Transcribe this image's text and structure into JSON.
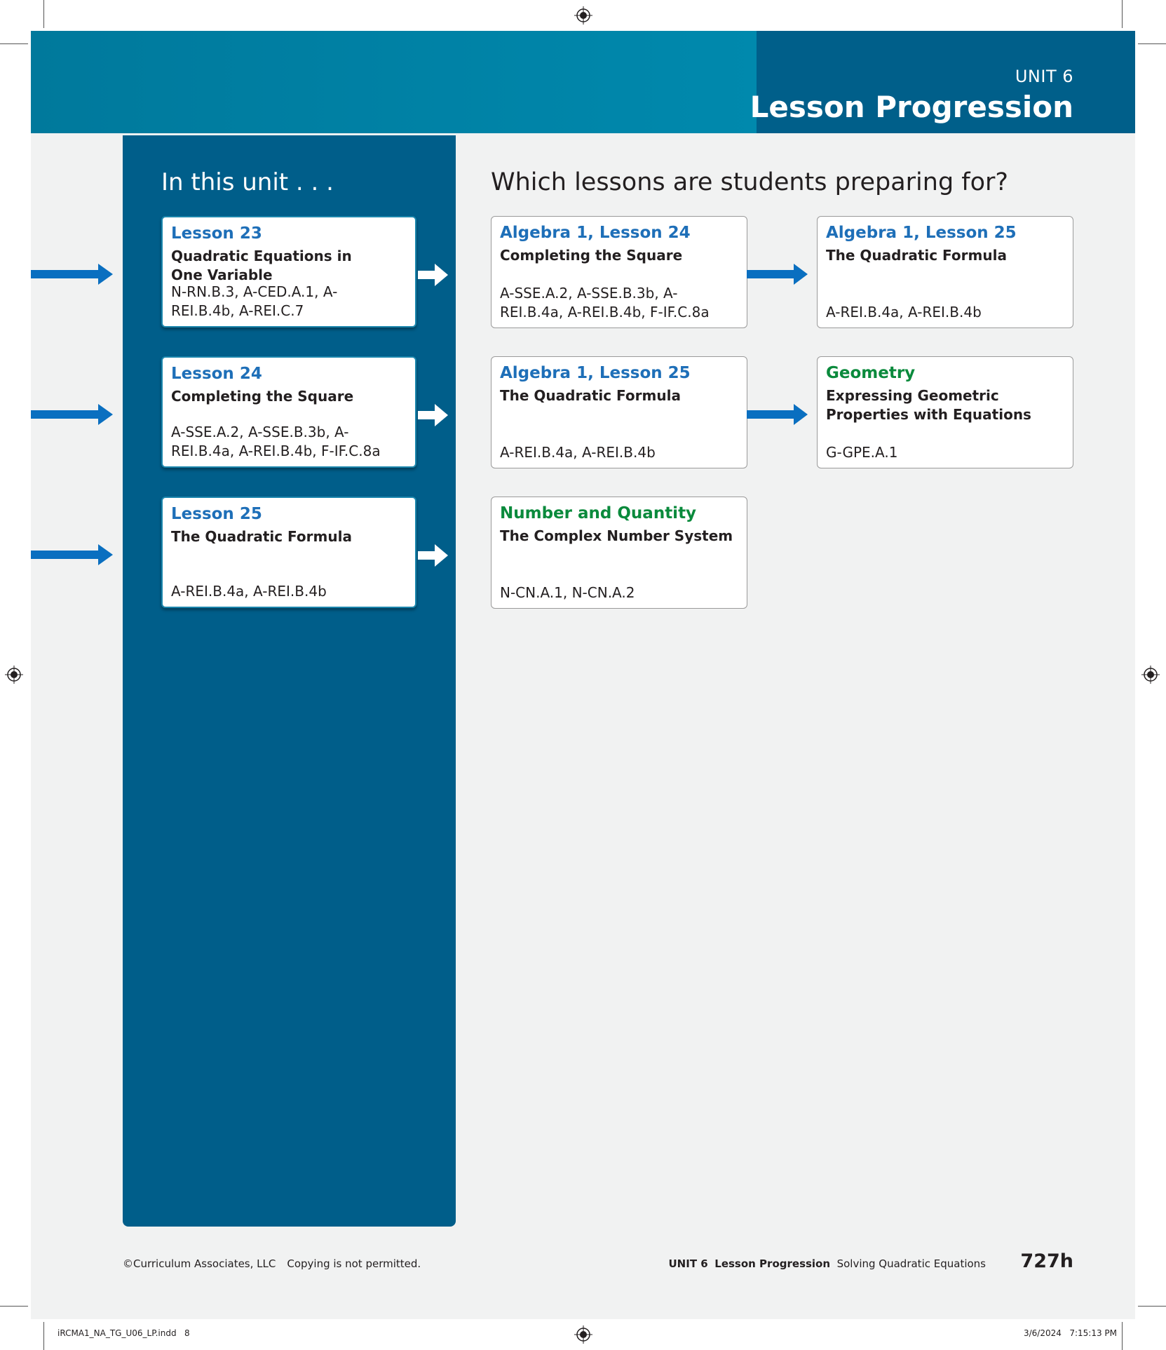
{
  "header": {
    "unit_label": "UNIT 6",
    "title": "Lesson Progression"
  },
  "left": {
    "heading": "In this unit . . .",
    "lessons": [
      {
        "title": "Lesson 23",
        "name": "Quadratic Equations in One Variable",
        "standards": "N-RN.B.3, A-CED.A.1, A-REI.B.4b, A-REI.C.7"
      },
      {
        "title": "Lesson 24",
        "name": "Completing the Square",
        "standards": "A-SSE.A.2, A-SSE.B.3b, A-REI.B.4a, A-REI.B.4b, F-IF.C.8a"
      },
      {
        "title": "Lesson 25",
        "name": "The Quadratic Formula",
        "standards": "A-REI.B.4a, A-REI.B.4b"
      }
    ]
  },
  "right": {
    "heading": "Which lessons are students preparing for?",
    "cards": [
      {
        "title": "Algebra 1, Lesson 24",
        "name": "Completing the Square",
        "standards": "A-SSE.A.2, A-SSE.B.3b, A-REI.B.4a, A-REI.B.4b, F-IF.C.8a"
      },
      {
        "title": "Algebra 1, Lesson 25",
        "name": "The Quadratic Formula",
        "standards": "A-REI.B.4a, A-REI.B.4b"
      },
      {
        "title": "Algebra 1, Lesson 25",
        "name": "The Quadratic Formula",
        "standards": "A-REI.B.4a, A-REI.B.4b"
      },
      {
        "title": "Geometry",
        "name": "Expressing Geometric Properties with Equations",
        "standards": "G-GPE.A.1"
      },
      {
        "title": "Number and Quantity",
        "name": "The Complex Number System",
        "standards": "N-CN.A.1, N-CN.A.2"
      }
    ]
  },
  "footer": {
    "copyright": "©Curriculum Associates, LLC",
    "notice": "Copying is not permitted.",
    "unit": "UNIT 6",
    "section": "Lesson Progression",
    "topic": "Solving Quadratic Equations",
    "page_number": "727h"
  },
  "slug": {
    "file": "iRCMA1_NA_TG_U06_LP.indd   8",
    "datetime": "3/6/2024   7:15:13 PM"
  },
  "colors": {
    "header_teal": "#0089ad",
    "header_dark": "#005f8a",
    "panel": "#005e8a",
    "lesson_title_blue": "#1e6fb8",
    "green_title": "#0a8a3c",
    "arrow_blue": "#0a6fc0"
  }
}
